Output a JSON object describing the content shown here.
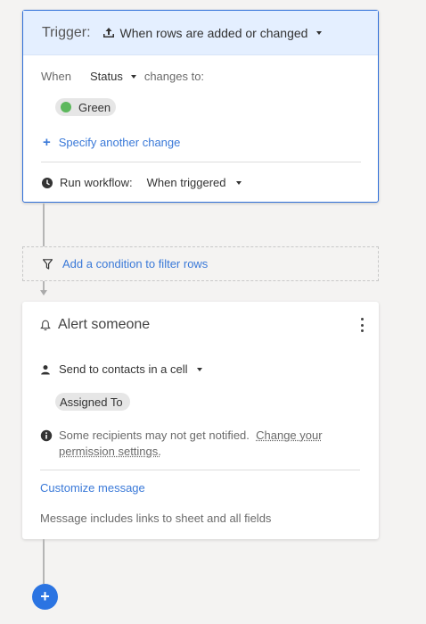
{
  "trigger": {
    "title": "Trigger:",
    "event": "When rows are added or changed",
    "when_label": "When",
    "field": "Status",
    "changes_label": "changes to:",
    "value": "Green",
    "value_color": "#5cb85c",
    "add_change_label": "Specify another change",
    "run_label": "Run workflow:",
    "run_value": "When triggered"
  },
  "condition": {
    "label": "Add a condition to filter rows"
  },
  "alert": {
    "title": "Alert someone",
    "send_label": "Send to contacts in a cell",
    "contact_field": "Assigned To",
    "notice_text": "Some recipients may not get notified.",
    "notice_link": "Change your permission settings.",
    "customize_label": "Customize message",
    "footer_text": "Message includes links to sheet and all fields"
  },
  "add_step_icon": "plus",
  "colors": {
    "accent": "#2b74e2",
    "link": "#3a79d8",
    "trigger_header_bg": "#e4efff"
  }
}
